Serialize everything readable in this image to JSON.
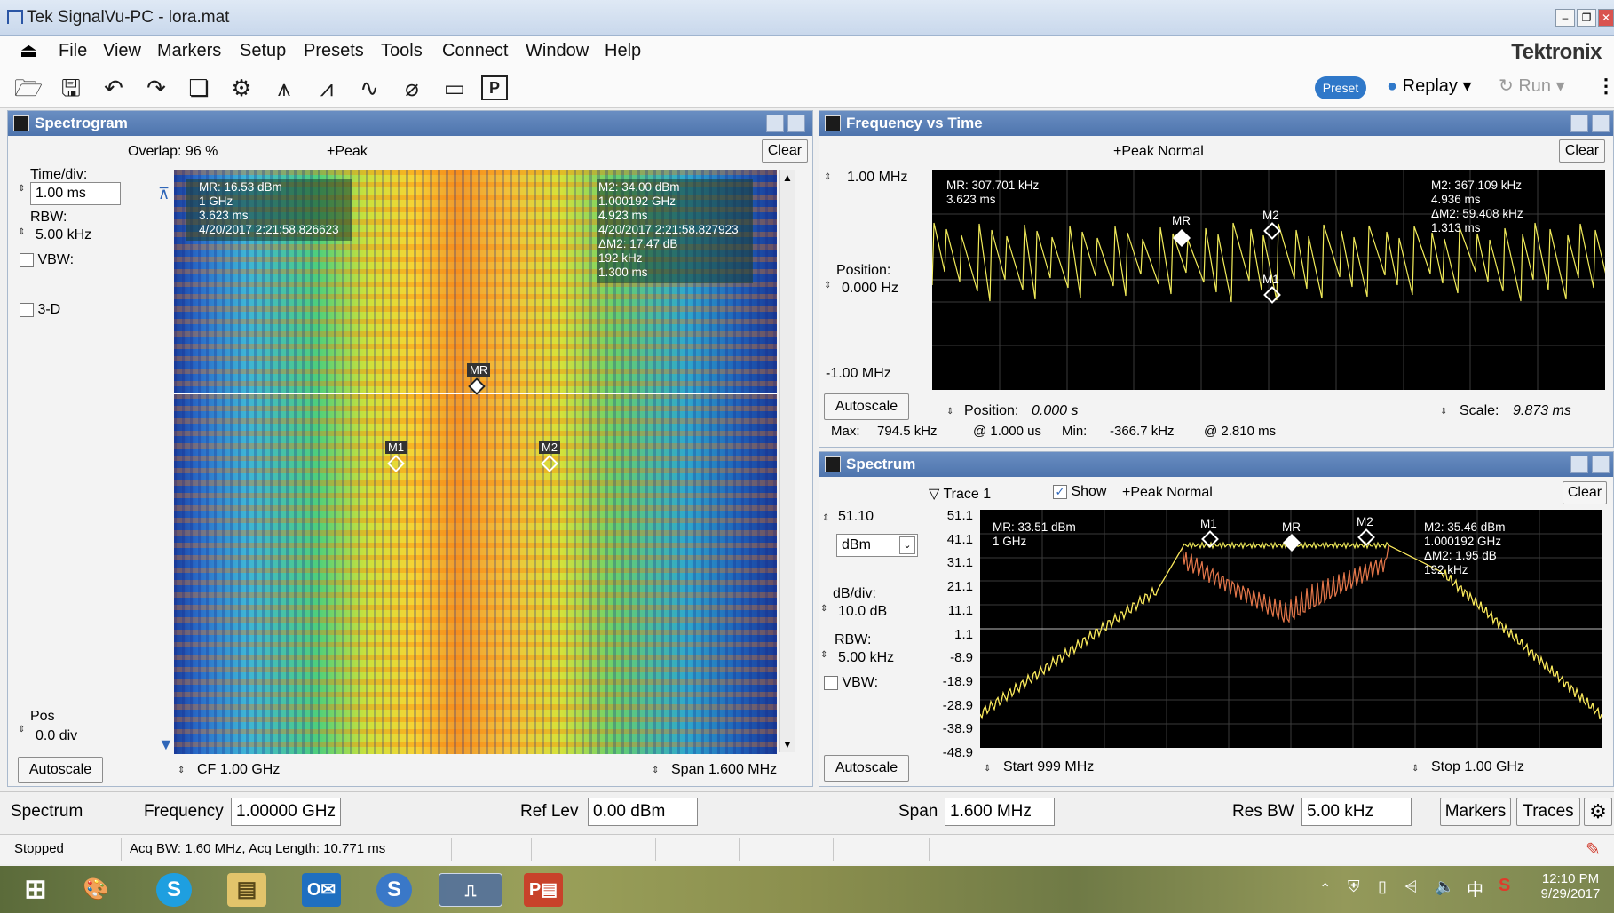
{
  "window": {
    "title": "Tek SignalVu-PC - lora.mat",
    "brand": "Tektronix"
  },
  "menu": [
    "File",
    "View",
    "Markers",
    "Setup",
    "Presets",
    "Tools",
    "Connect",
    "Window",
    "Help"
  ],
  "toolbar": {
    "preset_label": "Preset",
    "replay_label": "Replay",
    "run_label": "Run"
  },
  "spectrogram": {
    "title": "Spectrogram",
    "overlap": "Overlap: 96 %",
    "trace_mode": "+Peak",
    "clear": "Clear",
    "time_div_label": "Time/div:",
    "time_div_value": "1.00 ms",
    "rbw_label": "RBW:",
    "rbw_value": "5.00 kHz",
    "vbw_label": "VBW:",
    "threed_label": "3-D",
    "pos_label": "Pos",
    "pos_value": "0.0 div",
    "autoscale": "Autoscale",
    "cf": "CF  1.00 GHz",
    "span": "Span  1.600 MHz",
    "mr_readout": [
      "MR: 16.53 dBm",
      "1 GHz",
      "3.623 ms",
      "4/20/2017 2:21:58.826623"
    ],
    "m2_readout": [
      "M2: 34.00 dBm",
      "1.000192 GHz",
      "4.923 ms",
      "4/20/2017 2:21:58.827923",
      "ΔM2: 17.47 dB",
      "192 kHz",
      "1.300 ms"
    ],
    "markers": {
      "mr": "MR",
      "m1": "M1",
      "m2": "M2"
    }
  },
  "fvt": {
    "title": "Frequency vs Time",
    "trace_mode": "+Peak Normal",
    "clear": "Clear",
    "top": "1.00 MHz",
    "position_label": "Position:",
    "position_value": "0.000 Hz",
    "bottom": "-1.00 MHz",
    "autoscale": "Autoscale",
    "pos_time_label": "Position:",
    "pos_time_value": "0.000 s",
    "scale_label": "Scale:",
    "scale_value": "9.873 ms",
    "stats": [
      "Max:",
      "794.5 kHz",
      "@ 1.000 us",
      "Min:",
      "-366.7 kHz",
      "@ 2.810 ms"
    ],
    "mr_readout": [
      "MR: 307.701 kHz",
      "3.623 ms"
    ],
    "m2_readout": [
      "M2: 367.109 kHz",
      "4.936 ms",
      "ΔM2: 59.408 kHz",
      "1.313 ms"
    ],
    "markers": {
      "mr": "MR",
      "m1": "M1",
      "m2": "M2"
    }
  },
  "spectrum": {
    "title": "Spectrum",
    "trace_label": "Trace 1",
    "show_label": "Show",
    "trace_mode": "+Peak Normal",
    "clear": "Clear",
    "ref_value": "51.10",
    "unit": "dBm",
    "dbdiv_label": "dB/div:",
    "dbdiv_value": "10.0 dB",
    "rbw_label": "RBW:",
    "rbw_value": "5.00 kHz",
    "vbw_label": "VBW:",
    "autoscale": "Autoscale",
    "start": "Start   999 MHz",
    "stop": "Stop  1.00 GHz",
    "yticks": [
      "51.1",
      "41.1",
      "31.1",
      "21.1",
      "11.1",
      "1.1",
      "-8.9",
      "-18.9",
      "-28.9",
      "-38.9",
      "-48.9"
    ],
    "mr_readout": [
      "MR: 33.51 dBm",
      "1 GHz"
    ],
    "m2_readout": [
      "M2: 35.46 dBm",
      "1.000192 GHz",
      "ΔM2: 1.95 dB",
      "192 kHz"
    ],
    "markers": {
      "mr": "MR",
      "m1": "M1",
      "m2": "M2"
    }
  },
  "settings_bar": {
    "mode": "Spectrum",
    "freq_label": "Frequency",
    "freq_value": "1.00000 GHz",
    "reflev_label": "Ref Lev",
    "reflev_value": "0.00 dBm",
    "span_label": "Span",
    "span_value": "1.600 MHz",
    "resbw_label": "Res BW",
    "resbw_value": "5.00 kHz",
    "markers_btn": "Markers",
    "traces_btn": "Traces"
  },
  "status": {
    "state": "Stopped",
    "acq": "Acq BW: 1.60 MHz, Acq Length: 10.771 ms"
  },
  "taskbar": {
    "time": "12:10 PM",
    "date": "9/29/2017",
    "ime": "中"
  }
}
